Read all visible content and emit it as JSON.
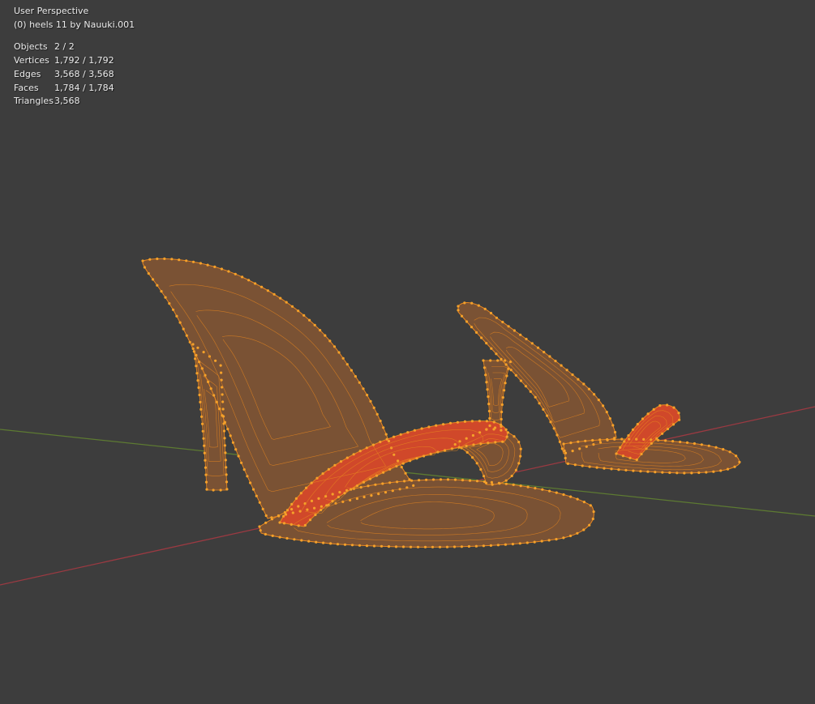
{
  "viewport": {
    "title": "User Perspective",
    "object_info": "(0) heels 11 by Nauuki.001",
    "stats": [
      {
        "label": "Objects",
        "value": "2 / 2"
      },
      {
        "label": "Vertices",
        "value": "1,792 / 1,792"
      },
      {
        "label": "Edges",
        "value": "3,568 / 3,568"
      },
      {
        "label": "Faces",
        "value": "1,784 / 1,784"
      },
      {
        "label": "Triangles",
        "value": "3,568"
      }
    ]
  },
  "colors": {
    "background": "#3d3d3d",
    "x_axis": "#9a3a42",
    "y_axis": "#5d7a32",
    "mesh_fill": "#7a5234",
    "mesh_wire": "#e8871f",
    "vertex": "#f5a12a",
    "strap": "#d0482a"
  }
}
